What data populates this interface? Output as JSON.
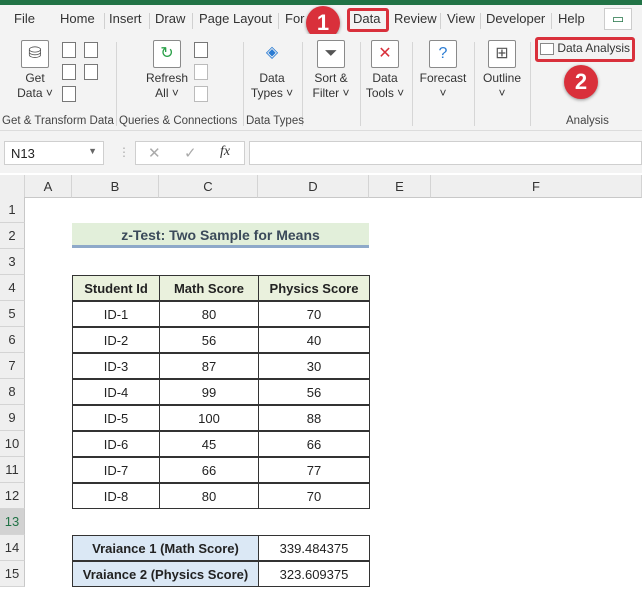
{
  "tabs": [
    "File",
    "Home",
    "Insert",
    "Draw",
    "Page Layout",
    "For",
    "Data",
    "Review",
    "View",
    "Developer",
    "Help"
  ],
  "badges": [
    "1",
    "2"
  ],
  "ribbon": {
    "get_data": [
      "Get",
      "Data ˅"
    ],
    "refresh": [
      "Refresh",
      "All ˅"
    ],
    "data_types": [
      "Data",
      "Types ˅"
    ],
    "sort_filter": [
      "Sort &",
      "Filter ˅"
    ],
    "data_tools": [
      "Data",
      "Tools ˅"
    ],
    "forecast": [
      "Forecast",
      "˅"
    ],
    "outline": [
      "Outline",
      "˅"
    ],
    "data_analysis": "Data Analysis",
    "groups": [
      "Get & Transform Data",
      "Queries & Connections",
      "Data Types",
      "Analysis"
    ]
  },
  "namebox": "N13",
  "fx": "fx",
  "columns": [
    "A",
    "B",
    "C",
    "D",
    "E",
    "F"
  ],
  "rows": [
    "1",
    "2",
    "3",
    "4",
    "5",
    "6",
    "7",
    "8",
    "9",
    "10",
    "11",
    "12",
    "13",
    "14",
    "15"
  ],
  "sheet": {
    "title": "z-Test: Two Sample for Means",
    "headers": [
      "Student Id",
      "Math  Score",
      "Physics  Score"
    ],
    "data": [
      [
        "ID-1",
        "80",
        "70"
      ],
      [
        "ID-2",
        "56",
        "40"
      ],
      [
        "ID-3",
        "87",
        "30"
      ],
      [
        "ID-4",
        "99",
        "56"
      ],
      [
        "ID-5",
        "100",
        "88"
      ],
      [
        "ID-6",
        "45",
        "66"
      ],
      [
        "ID-7",
        "66",
        "77"
      ],
      [
        "ID-8",
        "80",
        "70"
      ]
    ],
    "variances": [
      [
        "Vraiance 1 (Math Score)",
        "339.484375"
      ],
      [
        "Vraiance 2 (Physics Score)",
        "323.609375"
      ]
    ]
  }
}
